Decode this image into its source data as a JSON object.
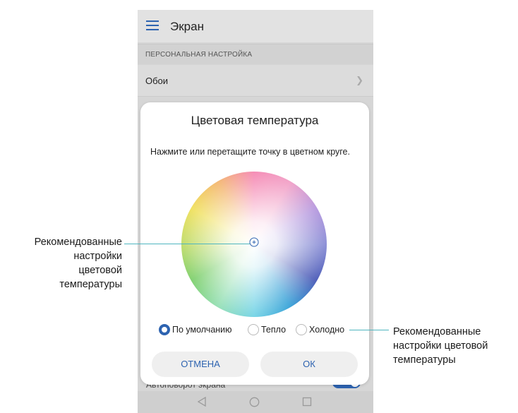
{
  "app_bar": {
    "title": "Экран",
    "menu_icon": "hamburger-menu-icon"
  },
  "section": {
    "header": "ПЕРСОНАЛЬНАЯ НАСТРОЙКА"
  },
  "settings": {
    "wallpaper_label": "Обои",
    "auto_rotate_label": "Автоповорот экрана",
    "auto_rotate_on": true
  },
  "dialog": {
    "title": "Цветовая температура",
    "instruction": "Нажмите или перетащите точку в цветном круге.",
    "options": [
      {
        "label": "По умолчанию",
        "checked": true
      },
      {
        "label": "Тепло",
        "checked": false
      },
      {
        "label": "Холодно",
        "checked": false
      }
    ],
    "cancel_label": "ОТМЕНА",
    "ok_label": "ОК"
  },
  "nav": {
    "back_icon": "back-triangle-icon",
    "home_icon": "home-circle-icon",
    "recent_icon": "recent-square-icon"
  },
  "callouts": {
    "left_lines": [
      "Рекомендованные",
      "настройки",
      "цветовой",
      "температуры"
    ],
    "right_lines": [
      "Рекомендованные",
      "настройки цветовой",
      "температуры"
    ]
  },
  "colors": {
    "accent": "#2d63b0",
    "leader_line": "#4fb6bf"
  }
}
